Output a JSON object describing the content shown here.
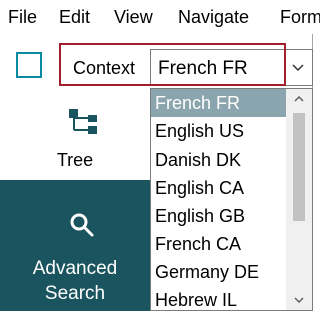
{
  "menu": {
    "items": [
      "File",
      "Edit",
      "View",
      "Navigate",
      "Form"
    ]
  },
  "sidebar": {
    "tree_label": "Tree",
    "advanced_search_line1": "Advanced",
    "advanced_search_line2": "Search"
  },
  "context": {
    "label": "Context",
    "selected_value": "French FR",
    "options": [
      "French FR",
      "English US",
      "Danish DK",
      "English CA",
      "English GB",
      "French CA",
      "Germany DE",
      "Hebrew IL"
    ]
  },
  "colors": {
    "accent_teal": "#1a545e",
    "highlight_red": "#a11f2a",
    "selected_option_bg": "#8aa5ad"
  }
}
